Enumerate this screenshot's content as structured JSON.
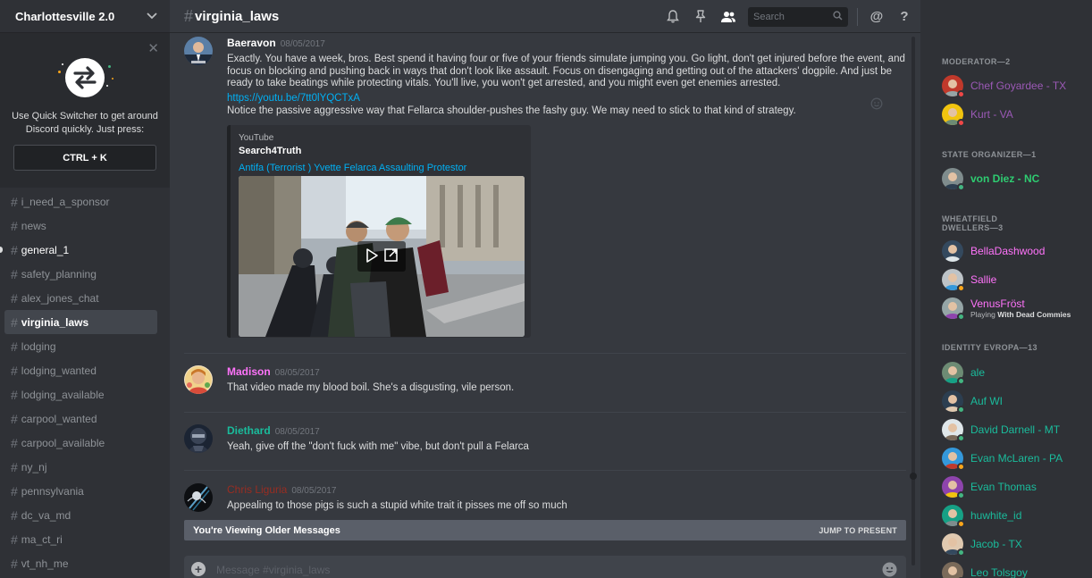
{
  "guild": {
    "name": "Charlottesville 2.0"
  },
  "quick_switcher": {
    "description": "Use Quick Switcher to get around Discord quickly. Just press:",
    "shortcut": "CTRL + K"
  },
  "channels": [
    {
      "name": "i_need_a_sponsor",
      "state": "normal"
    },
    {
      "name": "news",
      "state": "normal"
    },
    {
      "name": "general_1",
      "state": "unread"
    },
    {
      "name": "safety_planning",
      "state": "normal"
    },
    {
      "name": "alex_jones_chat",
      "state": "normal"
    },
    {
      "name": "virginia_laws",
      "state": "active"
    },
    {
      "name": "lodging",
      "state": "normal"
    },
    {
      "name": "lodging_wanted",
      "state": "normal"
    },
    {
      "name": "lodging_available",
      "state": "normal"
    },
    {
      "name": "carpool_wanted",
      "state": "normal"
    },
    {
      "name": "carpool_available",
      "state": "normal"
    },
    {
      "name": "ny_nj",
      "state": "normal"
    },
    {
      "name": "pennsylvania",
      "state": "normal"
    },
    {
      "name": "dc_va_md",
      "state": "normal"
    },
    {
      "name": "ma_ct_ri",
      "state": "normal"
    },
    {
      "name": "vt_nh_me",
      "state": "normal"
    }
  ],
  "header": {
    "channel_name": "virginia_laws",
    "search_placeholder": "Search",
    "mention_symbol": "@",
    "help_symbol": "?"
  },
  "messages": [
    {
      "author": "Baeravon",
      "author_color": "#ffffff",
      "timestamp": "08/05/2017",
      "text": "Exactly. You have a week, bros. Best spend it having four or five of your friends simulate jumping you. Go light, don't get injured before the event, and focus on blocking and pushing back in ways that don't look like assault. Focus on disengaging and getting out of the attackers' dogpile. And just be ready to take beatings while protecting vitals. You'll live, you won't get arrested, and you might even get enemies arrested.",
      "link": "https://youtu.be/7tt0lYQCTxA",
      "text2": "Notice the passive aggressive way that Fellarca shoulder-pushes the fashy guy. We may need to stick to that kind of strategy.",
      "embed": {
        "provider": "YouTube",
        "author": "Search4Truth",
        "title": "Antifa (Terrorist ) Yvette Felarca Assaulting Protestor"
      }
    },
    {
      "author": "Madison",
      "author_color": "#ff73fa",
      "timestamp": "08/05/2017",
      "text": "That video made my blood boil. She's a disgusting, vile person."
    },
    {
      "author": "Diethard",
      "author_color": "#1abc9c",
      "timestamp": "08/05/2017",
      "text": "Yeah, give off the \"don't fuck with me\" vibe, but don't pull a Felarca"
    },
    {
      "author": "Chris Liguria",
      "author_color": "#992d22",
      "timestamp": "08/05/2017",
      "text": "Appealing to those pigs is such a stupid white trait it pisses me off so much"
    }
  ],
  "older_banner": {
    "text": "You're Viewing Older Messages",
    "jump_label": "JUMP TO PRESENT"
  },
  "composer": {
    "placeholder": "Message #virginia_laws"
  },
  "member_list": [
    {
      "role": "MODERATOR—2",
      "members": [
        {
          "name": "Chef Goyardee - TX",
          "color": "#9b59b6",
          "status": "dnd"
        },
        {
          "name": "Kurt - VA",
          "color": "#9b59b6",
          "status": "dnd"
        }
      ]
    },
    {
      "role": "STATE ORGANIZER—1",
      "members": [
        {
          "name": "von Diez - NC",
          "color": "#2ecc71",
          "status": "online",
          "bold": true
        }
      ]
    },
    {
      "role": "WHEATFIELD DWELLERS—3",
      "members": [
        {
          "name": "BellaDashwood",
          "color": "#ff73fa",
          "status": "none"
        },
        {
          "name": "Sallie",
          "color": "#ff73fa",
          "status": "idle"
        },
        {
          "name": "VenusFröst",
          "color": "#ff73fa",
          "status": "online",
          "activity_prefix": "Playing ",
          "activity": "With Dead Commies"
        }
      ]
    },
    {
      "role": "IDENTITY EVROPA—13",
      "members": [
        {
          "name": "ale",
          "color": "#1abc9c",
          "status": "online"
        },
        {
          "name": "Auf WI",
          "color": "#1abc9c",
          "status": "online"
        },
        {
          "name": "David Darnell - MT",
          "color": "#1abc9c",
          "status": "online"
        },
        {
          "name": "Evan McLaren - PA",
          "color": "#1abc9c",
          "status": "idle"
        },
        {
          "name": "Evan Thomas",
          "color": "#1abc9c",
          "status": "online"
        },
        {
          "name": "huwhite_id",
          "color": "#1abc9c",
          "status": "idle"
        },
        {
          "name": "Jacob - TX",
          "color": "#1abc9c",
          "status": "online"
        },
        {
          "name": "Leo Tolsgoy",
          "color": "#1abc9c",
          "status": "online"
        }
      ]
    }
  ],
  "colors": {
    "link": "#00b0f4",
    "online": "#43b581",
    "idle": "#faa61a",
    "dnd": "#f04747",
    "background": "#36393f",
    "sidebar": "#2f3136"
  }
}
